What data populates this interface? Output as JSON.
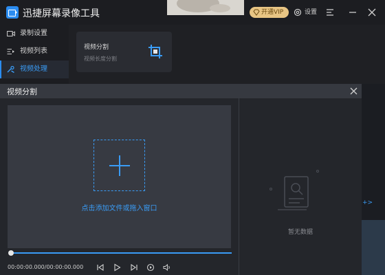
{
  "app": {
    "title": "迅捷屏幕录像工具"
  },
  "header": {
    "vip_label": "开通VIP",
    "settings_label": "设置"
  },
  "sidebar": {
    "items": [
      {
        "label": "录制设置",
        "icon": "camera-icon",
        "active": false
      },
      {
        "label": "视频列表",
        "icon": "list-icon",
        "active": false
      },
      {
        "label": "视频处理",
        "icon": "tools-icon",
        "active": true
      }
    ]
  },
  "tool_card": {
    "title": "视频分割",
    "subtitle": "视频长度分割",
    "icon": "crop-icon"
  },
  "dialog": {
    "title": "视频分割",
    "drop_hint": "点击添加文件或拖入窗口",
    "time": "00:00:00.000/00:00:00.000",
    "progress": 1.0,
    "empty_text": "暂无数据",
    "controls": [
      "prev-icon",
      "play-icon",
      "next-icon",
      "loop-icon",
      "volume-icon"
    ]
  },
  "right_edge": {
    "arrow": "+>"
  },
  "colors": {
    "accent": "#3a9cf6",
    "vip": "#e8c584",
    "panel": "#373a42"
  }
}
